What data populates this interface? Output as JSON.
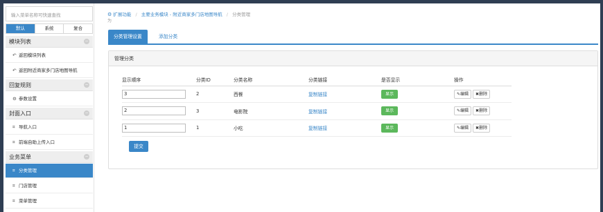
{
  "sidebar": {
    "search_placeholder": "输入菜单名称可快速查找",
    "tabs": [
      {
        "label": "默认",
        "active": true
      },
      {
        "label": "系统",
        "active": false
      },
      {
        "label": "复合",
        "active": false
      }
    ],
    "groups": [
      {
        "title": "模块列表",
        "items": [
          {
            "label": "返回模块列表",
            "icon": "reply-icon"
          },
          {
            "label": "返回附近商家多门店地图导航",
            "icon": "reply-icon"
          }
        ]
      },
      {
        "title": "回复规则",
        "items": [
          {
            "label": "参数设置",
            "icon": "gear-icon"
          }
        ]
      },
      {
        "title": "封面入口",
        "items": [
          {
            "label": "导航入口",
            "icon": "sitemap-icon"
          },
          {
            "label": "前端自助上传入口",
            "icon": "sitemap-icon"
          }
        ]
      },
      {
        "title": "业务菜单",
        "items": [
          {
            "label": "分类管理",
            "icon": "sitemap-icon",
            "active": true
          },
          {
            "label": "门店管理",
            "icon": "sitemap-icon"
          },
          {
            "label": "菜单管理",
            "icon": "sitemap-icon"
          }
        ]
      }
    ]
  },
  "breadcrumb": {
    "items": [
      "扩展功能",
      "主要业务模块 - 附近商家多门店地图导航",
      "分类管理"
    ],
    "sub": "为"
  },
  "nav_tabs": {
    "active": "分类管理设置",
    "other": "添加分类"
  },
  "panel": {
    "title": "管理分类",
    "columns": [
      "显示顺序",
      "分类ID",
      "分类名称",
      "分类链接",
      "是否显示",
      "操作"
    ],
    "rows": [
      {
        "order": "3",
        "id": "2",
        "name": "西餐",
        "link": "复制链接",
        "show": "显示",
        "edit": "编辑",
        "delete": "删除"
      },
      {
        "order": "2",
        "id": "3",
        "name": "电影院",
        "link": "复制链接",
        "show": "显示",
        "edit": "编辑",
        "delete": "删除"
      },
      {
        "order": "1",
        "id": "1",
        "name": "小吃",
        "link": "复制链接",
        "show": "显示",
        "edit": "编辑",
        "delete": "删除"
      }
    ],
    "submit_label": "提交"
  },
  "colors": {
    "accent": "#3a87c8",
    "success": "#5cb85c",
    "outer_bg": "#2f3e53"
  }
}
